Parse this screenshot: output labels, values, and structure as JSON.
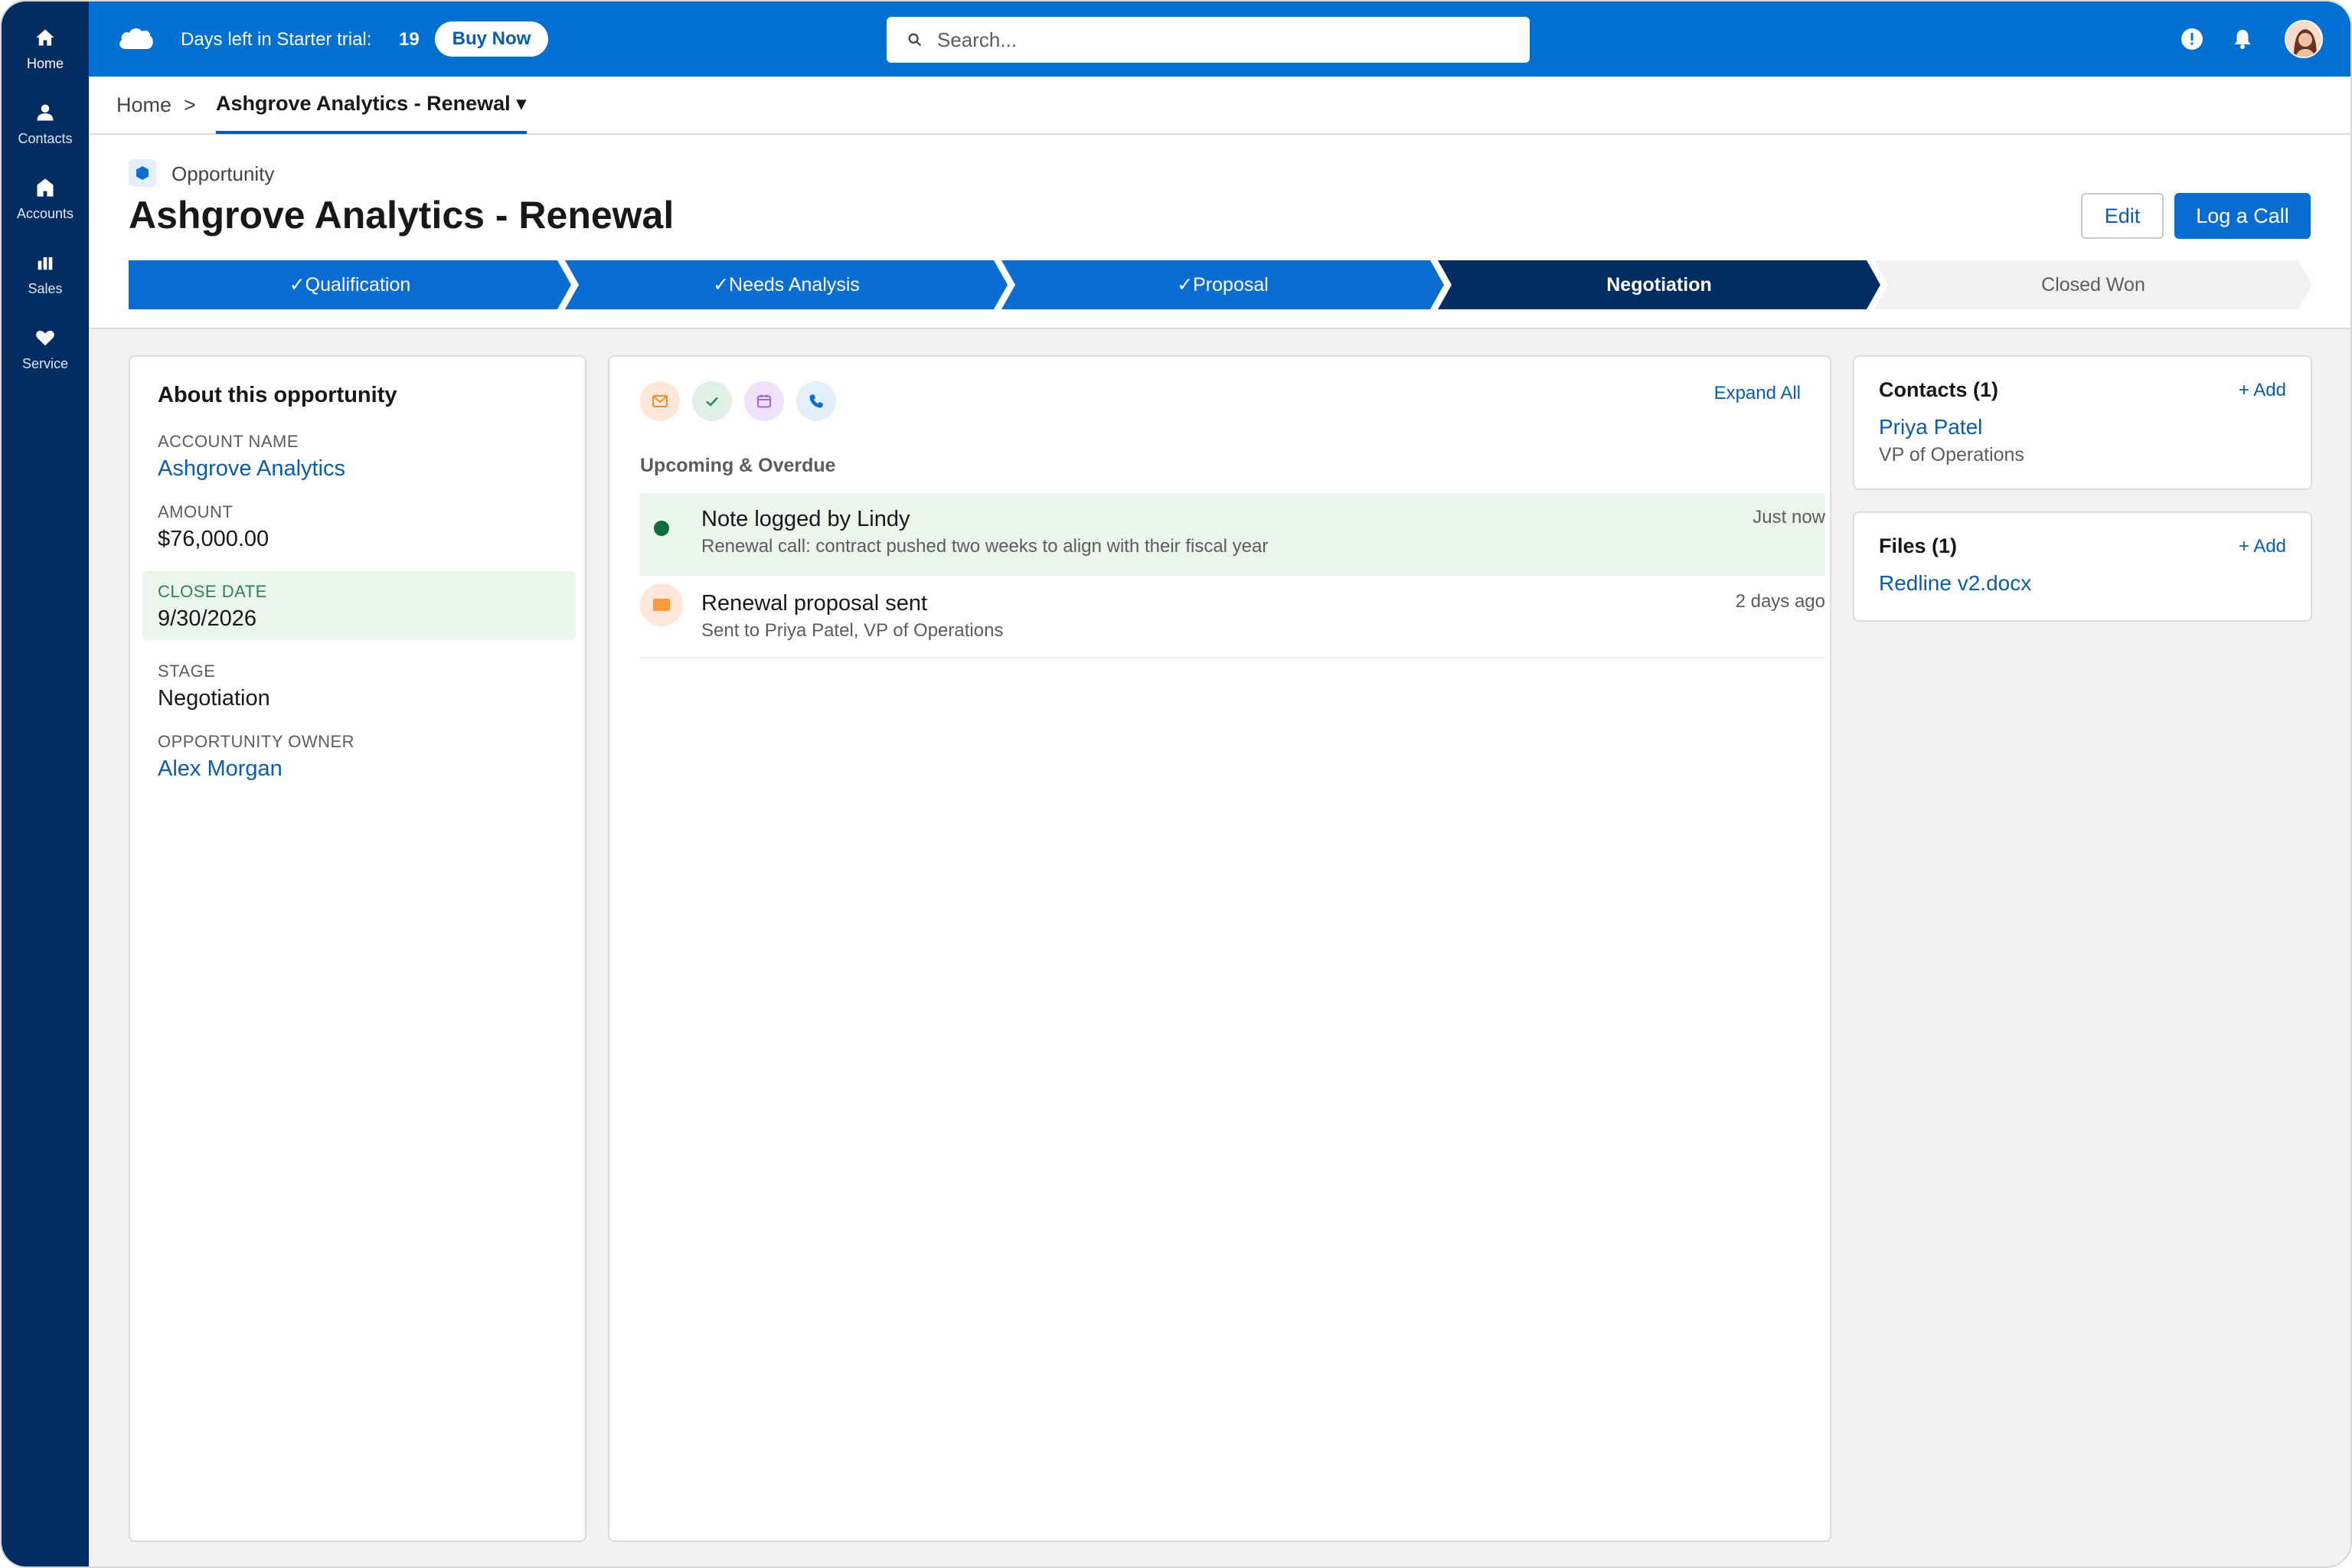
{
  "nav": {
    "items": [
      {
        "label": "Home",
        "icon": "home-icon"
      },
      {
        "label": "Contacts",
        "icon": "person-icon"
      },
      {
        "label": "Accounts",
        "icon": "building-icon"
      },
      {
        "label": "Sales",
        "icon": "bar-chart-icon"
      },
      {
        "label": "Service",
        "icon": "heart-icon"
      }
    ],
    "active": "Home"
  },
  "topbar": {
    "trial_text": "Days left in Starter trial:",
    "trial_days": "19",
    "buy_now": "Buy Now",
    "search_placeholder": "Search..."
  },
  "breadcrumb": {
    "home": "Home",
    "separator": ">",
    "current": "Ashgrove Analytics - Renewal ▾"
  },
  "record": {
    "object_type": "Opportunity",
    "title": "Ashgrove Analytics - Renewal",
    "edit_label": "Edit",
    "log_call_label": "Log a Call"
  },
  "path": {
    "stages": [
      {
        "label": "✓Qualification",
        "state": "complete"
      },
      {
        "label": "✓Needs Analysis",
        "state": "complete"
      },
      {
        "label": "✓Proposal",
        "state": "complete"
      },
      {
        "label": "Negotiation",
        "state": "current"
      },
      {
        "label": "Closed Won",
        "state": "incomplete"
      }
    ]
  },
  "about": {
    "title": "About this opportunity",
    "account_name_label": "ACCOUNT NAME",
    "account_name": "Ashgrove Analytics",
    "amount_label": "AMOUNT",
    "amount": "$76,000.00",
    "close_date_label": "CLOSE DATE",
    "close_date": "9/30/2026",
    "stage_label": "STAGE",
    "stage": "Negotiation",
    "owner_label": "OPPORTUNITY OWNER",
    "owner": "Alex Morgan"
  },
  "activity": {
    "expand_all": "Expand All",
    "section": "Upcoming & Overdue",
    "items": [
      {
        "title": "Note logged by Lindy",
        "subtitle": "Renewal call: contract pushed two weeks to align with their fiscal year",
        "time": "Just now"
      },
      {
        "title": "Renewal proposal sent",
        "subtitle": "Sent to Priya Patel, VP of Operations",
        "time": "2 days ago"
      }
    ]
  },
  "contacts": {
    "title": "Contacts (1)",
    "add": "+ Add",
    "name": "Priya Patel",
    "role": "VP of Operations"
  },
  "files": {
    "title": "Files (1)",
    "add": "+ Add",
    "file": "Redline v2.docx"
  },
  "colors": {
    "brand": "#0070d2",
    "rail": "#032d60",
    "path_complete": "#0b6dd1",
    "path_current": "#032d60",
    "path_incomplete": "#f3f2f2",
    "link": "#0b5cab"
  }
}
